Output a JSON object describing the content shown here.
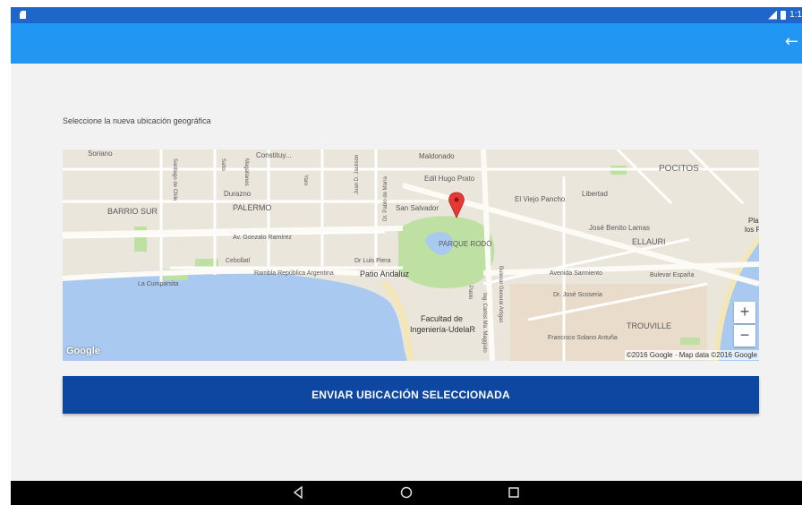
{
  "status_bar": {
    "time": "1:1"
  },
  "app_bar": {
    "back_icon": "arrow-left-icon"
  },
  "instruction": "Seleccione la nueva ubicación geográfica",
  "map": {
    "labels": {
      "soriano": "Soriano",
      "constituyente": "Constituy...",
      "maldonado": "Maldonado",
      "edil_hugo_prato": "Edil Hugo Prato",
      "pocitos": "POCITOS",
      "barrio_sur": "BARRIO SUR",
      "palermo": "PALERMO",
      "durazno": "Durazno",
      "san_salvador": "San Salvador",
      "el_viejo_pancho": "El Viejo Pancho",
      "libertad": "Libertad",
      "av_gonzalo_ramirez": "Av. Gonzalo Ramírez",
      "parque_rodo": "PARQUE RODÓ",
      "jose_benito_lamas": "José Benito Lamas",
      "ellauri": "ELLAURI",
      "cebollati": "Cebollatí",
      "dr_luis_piera": "Dr Luis Piera",
      "rambla_republica_argentina": "Rambla República Argentina",
      "patio_andaluz": "Patio Andaluz",
      "la_cumparsita": "La Cumparsita",
      "avenida_sarmiento": "Avenida Sarmiento",
      "bulevar_espana": "Bulevar España",
      "dr_jose_scoseria": "Dr. José Scoseria",
      "facultad_1": "Facultad de",
      "facultad_2": "Ingeniería-UdelaR",
      "trouville": "TROUVILLE",
      "francisco_solano": "Francisco Solano Antuña",
      "playa_1": "Pla",
      "playa_2": "los P",
      "santiago_de_chile": "Santiago de Chile",
      "salto": "Salto",
      "magallanes": "Magallanes",
      "yaro": "Yaro",
      "juan_d_jackson": "Juan D. Jackson",
      "dr_pablo_de_maria": "Dr. Pablo de María",
      "bulevar_artigas": "Bulevar General Artigas",
      "ing_carlos_m_maggiolo": "Ing. Carlos Ma. Maggiolo",
      "pablo": "Pablo"
    },
    "zoom_in": "+",
    "zoom_out": "−",
    "google_logo": "Google",
    "attribution": "©2016 Google · Map data ©2016 Google",
    "marker_color": "#e53935"
  },
  "send_button": "ENVIAR UBICACIÓN SELECCIONADA",
  "nav": {
    "back": "back-triangle-icon",
    "home": "home-circle-icon",
    "recents": "recents-square-icon"
  },
  "colors": {
    "status_bar": "#1e66c9",
    "app_bar": "#2196f3",
    "button": "#0d47a1"
  }
}
